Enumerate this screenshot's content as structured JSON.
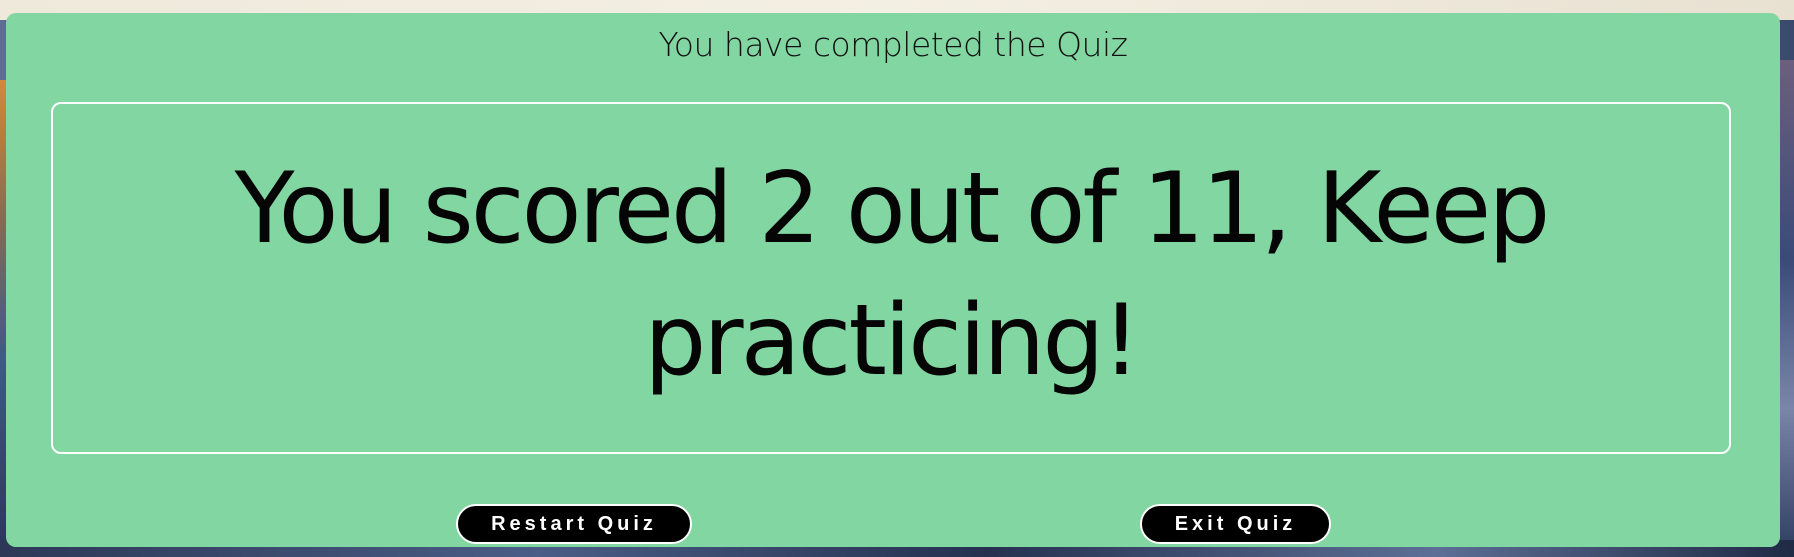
{
  "quiz_result": {
    "title": "You have completed the Quiz",
    "score_message": "You scored 2 out of 11, Keep practicing!",
    "score": 2,
    "total_questions": 11
  },
  "actions": {
    "restart_label": "Restart Quiz",
    "exit_label": "Exit Quiz"
  },
  "colors": {
    "card_background": "#82d6a2",
    "button_background": "#000000",
    "button_text": "#ffffff",
    "border": "#ffffff"
  }
}
